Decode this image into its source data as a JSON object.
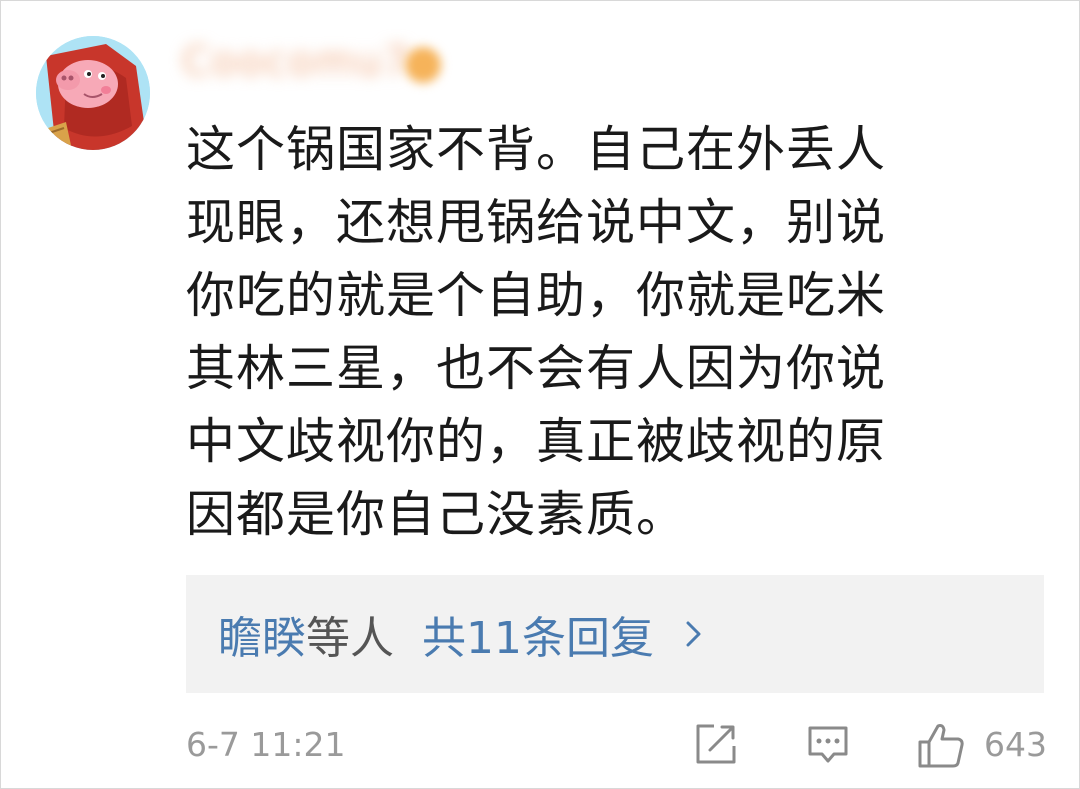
{
  "comment": {
    "username": "Coocomu7",
    "text": "这个锅国家不背。自己在外丢人\n现眼，还想甩锅给说中文，别说\n你吃的就是个自助，你就是吃米\n其林三星，也不会有人因为你说\n中文歧视你的，真正被歧视的原\n因都是你自己没素质。"
  },
  "replies": {
    "names": "瞻睽",
    "etc": "等人",
    "count_label": "共11条回复"
  },
  "footer": {
    "timestamp": "6-7 11:21",
    "like_count": "643"
  },
  "icons": [
    "chevron-right-icon",
    "share-icon",
    "comment-icon",
    "like-icon"
  ],
  "colors": {
    "link_blue": "#4a7bb0",
    "reply_box_bg": "#f2f2f2",
    "muted_gray": "#9a9a9a"
  }
}
